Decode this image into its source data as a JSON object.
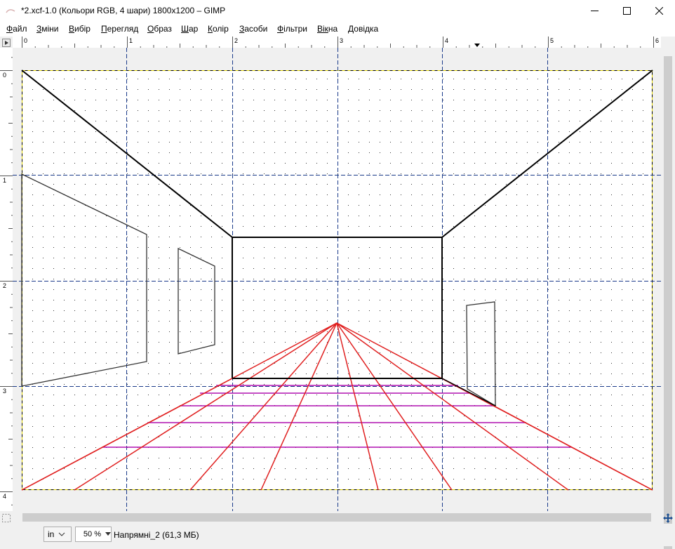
{
  "window": {
    "title": "*2.xcf-1.0 (Кольори RGB, 4 шари) 1800x1200 – GIMP",
    "controls": [
      "minimize-icon",
      "maximize-icon",
      "close-icon"
    ]
  },
  "menu": [
    {
      "label": "Файл",
      "u": "Ф",
      "rest": "айл"
    },
    {
      "label": "Зміни",
      "u": "З",
      "rest": "міни"
    },
    {
      "label": "Вибір",
      "u": "В",
      "rest": "ибір"
    },
    {
      "label": "Перегляд",
      "u": "П",
      "rest": "ерегляд"
    },
    {
      "label": "Образ",
      "u": "О",
      "rest": "браз"
    },
    {
      "label": "Шар",
      "u": "Ш",
      "rest": "ар"
    },
    {
      "label": "Колір",
      "u": "К",
      "rest": "олір"
    },
    {
      "label": "Засоби",
      "u": "З",
      "rest": "асоби"
    },
    {
      "label": "Фільтри",
      "u": "Ф",
      "rest": "ільтри"
    },
    {
      "label": "Вікна",
      "u": "Вік",
      "rest": "на"
    },
    {
      "label": "Довідка",
      "u": "Д",
      "rest": "овідка"
    }
  ],
  "rulers": {
    "horizontal_labels": [
      "0",
      "1",
      "2",
      "3",
      "4",
      "5",
      "6"
    ],
    "vertical_labels": [
      "0",
      "1",
      "2",
      "3",
      "4"
    ]
  },
  "colors": {
    "guide": "#1a3a8a",
    "outline": "#000000",
    "perspective_lines": "#e02020",
    "floor_lines": "#b010b0",
    "selection": "#e6d800"
  },
  "statusbar": {
    "unit": "in",
    "zoom": "50 %",
    "status": "Напрямні_2 (61,3 МБ)"
  }
}
